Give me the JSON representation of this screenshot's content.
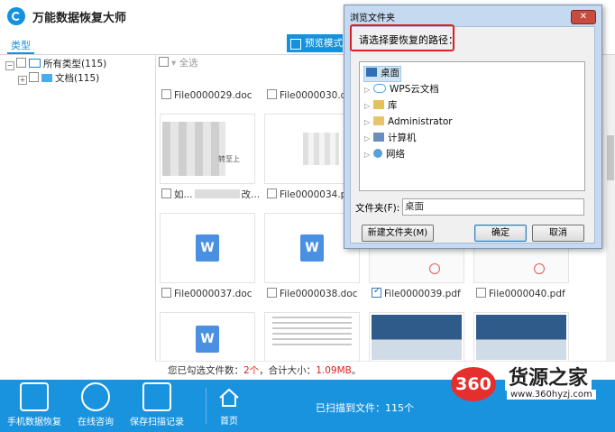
{
  "app": {
    "title": "万能数据恢复大师"
  },
  "toolbar": {
    "tab_type": "类型",
    "preview_mode": "预览模式"
  },
  "tree": {
    "all_types": "所有类型(115)",
    "documents": "文档(115)"
  },
  "grid": {
    "select_all": "全选",
    "files": [
      {
        "name": "File0000029.doc",
        "checked": false
      },
      {
        "name": "File0000030.doc",
        "checked": false
      },
      {
        "name": "如...",
        "checked": false
      },
      {
        "name": "File0000034.pdf",
        "checked": false
      },
      {
        "name": "File0000037.doc",
        "checked": false
      },
      {
        "name": "File0000038.doc",
        "checked": false
      },
      {
        "name": "File0000039.pdf",
        "checked": true
      },
      {
        "name": "File0000040.pdf",
        "checked": false
      }
    ],
    "thumb_blur_text": "转至上",
    "thumb_ellipsis": "改..."
  },
  "status": {
    "prefix": "您已勾选文件数：",
    "count": "2个",
    "size_prefix": "，合计大小：",
    "size": "1.09MB",
    "suffix": "。"
  },
  "bottom_bar": {
    "phone_recovery": "手机数据恢复",
    "online_help": "在线咨询",
    "save_scan": "保存扫描记录",
    "home": "首页",
    "scanned": "已扫描到文件：115个"
  },
  "dialog": {
    "title": "浏览文件夹",
    "close": "✕",
    "prompt": "请选择要恢复的路径：",
    "items": [
      "桌面",
      "WPS云文档",
      "库",
      "Administrator",
      "计算机",
      "网络"
    ],
    "folder_label": "文件夹(F):",
    "folder_value": "桌面",
    "new_folder": "新建文件夹(M)",
    "ok": "确定",
    "cancel": "取消"
  },
  "watermark": {
    "badge": "360",
    "name": "货源之家",
    "url": "www.360hyzj.com"
  },
  "colors": {
    "accent": "#1a93df",
    "highlight": "#e02020"
  }
}
